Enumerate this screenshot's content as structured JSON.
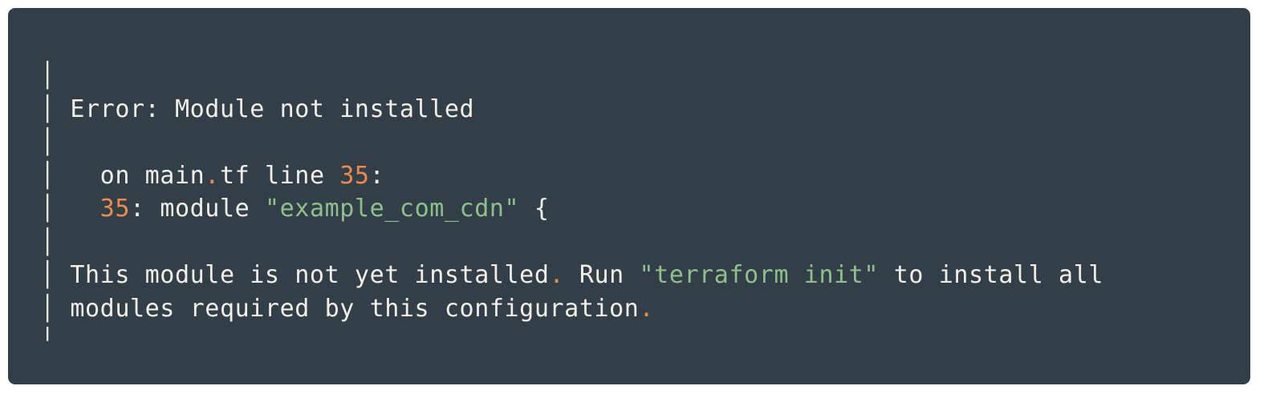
{
  "code_block": {
    "lines": [
      {
        "bar": "│",
        "parts": []
      },
      {
        "bar": "│",
        "parts": [
          {
            "t": " Error: Module not installed",
            "c": ""
          }
        ]
      },
      {
        "bar": "│",
        "parts": []
      },
      {
        "bar": "│",
        "parts": [
          {
            "t": "   on main",
            "c": ""
          },
          {
            "t": ".",
            "c": "o"
          },
          {
            "t": "tf line ",
            "c": ""
          },
          {
            "t": "35",
            "c": "o"
          },
          {
            "t": ":",
            "c": ""
          }
        ]
      },
      {
        "bar": "│",
        "parts": [
          {
            "t": "   ",
            "c": ""
          },
          {
            "t": "35",
            "c": "o"
          },
          {
            "t": ": module ",
            "c": ""
          },
          {
            "t": "\"example_com_cdn\"",
            "c": "g"
          },
          {
            "t": " {",
            "c": ""
          }
        ]
      },
      {
        "bar": "│",
        "parts": []
      },
      {
        "bar": "│",
        "parts": [
          {
            "t": " This module is not yet installed",
            "c": ""
          },
          {
            "t": ".",
            "c": "o"
          },
          {
            "t": " Run ",
            "c": ""
          },
          {
            "t": "\"terraform init\"",
            "c": "g"
          },
          {
            "t": " to install all",
            "c": ""
          }
        ]
      },
      {
        "bar": "│",
        "parts": [
          {
            "t": " modules required by this configuration",
            "c": ""
          },
          {
            "t": ".",
            "c": "o"
          }
        ]
      },
      {
        "bar": "╵",
        "parts": []
      }
    ]
  },
  "colors": {
    "background": "#323f48",
    "text": "#f2eee6",
    "number": "#f08a4b",
    "string": "#8fc08a"
  }
}
